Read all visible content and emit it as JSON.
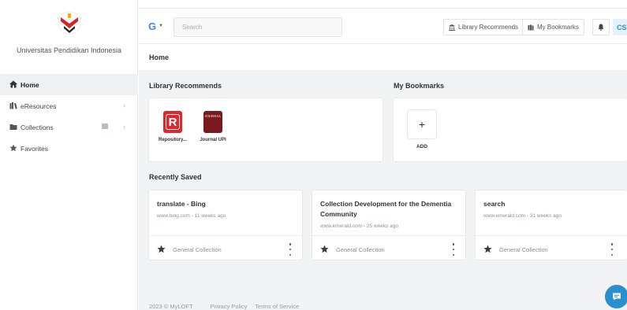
{
  "sidebar": {
    "university_name": "Universitas Pendidikan Indonesia",
    "items": [
      {
        "label": "Home",
        "icon": "home-icon",
        "active": true
      },
      {
        "label": "eResources",
        "icon": "books-icon"
      },
      {
        "label": "Collections",
        "icon": "folder-icon"
      },
      {
        "label": "Favorites",
        "icon": "star-icon"
      }
    ]
  },
  "topbar": {
    "search_engine": "G",
    "search_placeholder": "Search",
    "library_recommends_label": "Library Recommends",
    "my_bookmarks_label": "My Bookmarks",
    "avatar_initials": "CS"
  },
  "breadcrumb": "Home",
  "library_recommends": {
    "title": "Library Recommends",
    "items": [
      {
        "label": "Repository...",
        "logo_text": "R"
      },
      {
        "label": "Journal UPI",
        "logo_text": "JOURNAL"
      }
    ]
  },
  "bookmarks": {
    "title": "My Bookmarks",
    "add_label": "ADD"
  },
  "recently_saved": {
    "title": "Recently Saved",
    "items": [
      {
        "title": "translate - Bing",
        "meta": "www.bing.com - 11 weeks ago",
        "collection": "General Collection"
      },
      {
        "title": "Collection Development for the Dementia Community",
        "meta": "www.emerald.com - 25 weeks ago",
        "collection": "General Collection"
      },
      {
        "title": "search",
        "meta": "www.emerald.com - 31 weeks ago",
        "collection": "General Collection"
      }
    ]
  },
  "footer": {
    "copyright": "2023 © MyLOFT",
    "privacy": "Privacy Policy",
    "terms": "Terms of Service"
  },
  "colors": {
    "accent": "#2a8fd0",
    "google_blue": "#4285F4",
    "repository_red": "#e3262b",
    "journal_maroon": "#7a1a1f"
  }
}
